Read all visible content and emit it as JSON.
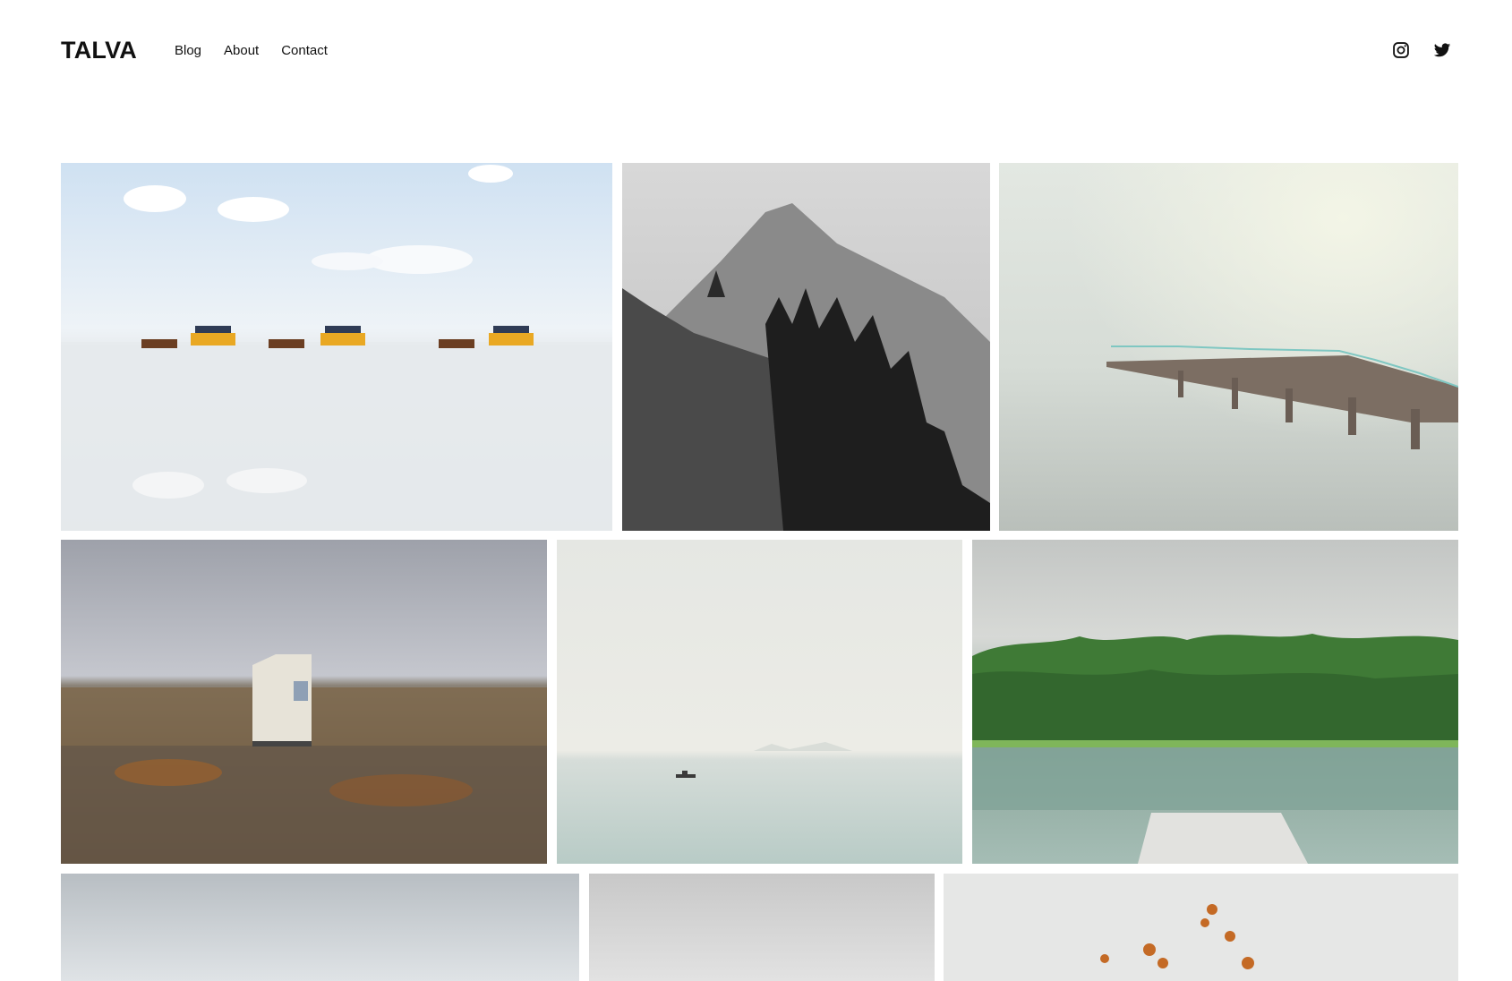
{
  "site": {
    "logo": "TALVA"
  },
  "nav": {
    "items": [
      "Blog",
      "About",
      "Contact"
    ]
  },
  "social": {
    "icons": [
      "instagram-icon",
      "twitter-icon"
    ]
  },
  "gallery": {
    "photos": [
      "horse-carriages-on-tidal-flat",
      "black-and-white-mountain-cliff",
      "misty-pier-in-water",
      "white-hut-on-rocky-tundra",
      "small-boat-on-calm-sea",
      "green-forest-over-lake-with-dock",
      "overcast-sky-landscape",
      "grey-misty-landscape",
      "autumn-branches-landscape"
    ]
  }
}
